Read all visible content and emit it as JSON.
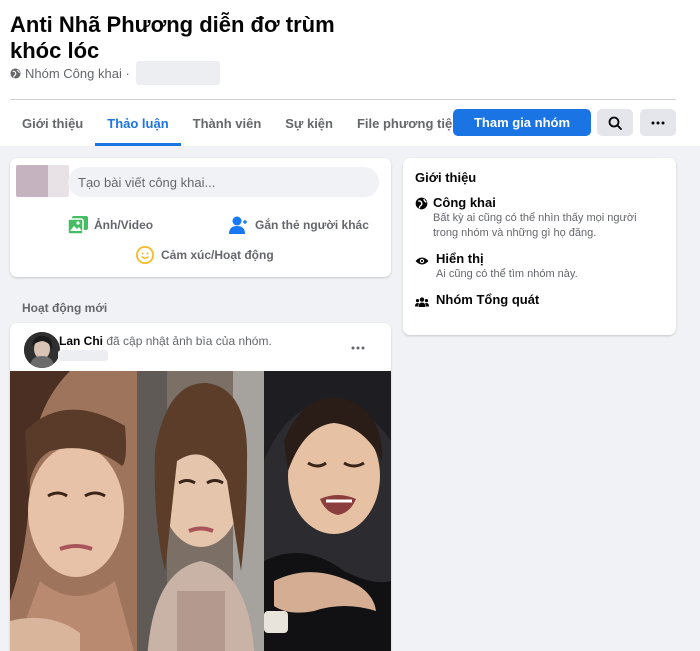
{
  "group": {
    "title": "Anti Nhã Phương diễn đơ trùm khóc lóc",
    "privacy_label": "Nhóm Công khai ·"
  },
  "tabs": [
    {
      "label": "Giới thiệu"
    },
    {
      "label": "Thảo luận"
    },
    {
      "label": "Thành viên"
    },
    {
      "label": "Sự kiện"
    },
    {
      "label": "File phương tiện"
    }
  ],
  "header_actions": {
    "join_label": "Tham gia nhóm",
    "search_icon": "search-icon",
    "more_icon": "more-horizontal-icon"
  },
  "composer": {
    "placeholder": "Tạo bài viết công khai...",
    "photo_label": "Ảnh/Video",
    "tag_label": "Gắn thẻ người khác",
    "feeling_label": "Cảm xúc/Hoạt động"
  },
  "about": {
    "heading": "Giới thiệu",
    "items": [
      {
        "title": "Công khai",
        "desc": "Bất kỳ ai cũng có thể nhìn thấy mọi người trong nhóm và những gì họ đăng.",
        "icon": "globe-icon"
      },
      {
        "title": "Hiển thị",
        "desc": "Ai cũng có thể tìm nhóm này.",
        "icon": "eye-icon"
      },
      {
        "title": "Nhóm Tổng quát",
        "icon": "group-icon"
      }
    ]
  },
  "feed": {
    "section_label": "Hoạt động mới",
    "post": {
      "author": "Lan Chi",
      "action": "đã cập nhật ảnh bìa của nhóm."
    }
  },
  "colors": {
    "accent": "#1b74e4",
    "background": "#f0f2f5",
    "secondary_text": "#65676b"
  }
}
